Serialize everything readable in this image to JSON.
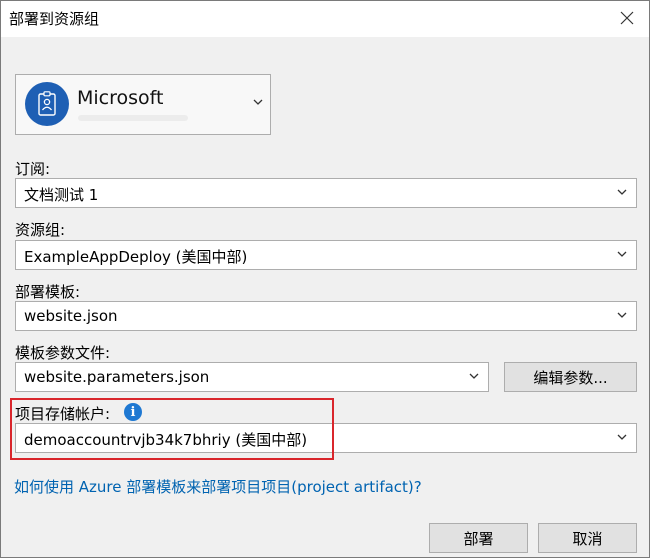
{
  "dialog": {
    "title": "部署到资源组",
    "close_icon": "close-icon"
  },
  "account": {
    "name": "Microsoft",
    "icon": "id-badge-icon"
  },
  "subscription": {
    "label": "订阅:",
    "value": "文档测试 1"
  },
  "resource_group": {
    "label": "资源组:",
    "value": "ExampleAppDeploy (美国中部)"
  },
  "deployment_template": {
    "label": "部署模板:",
    "value": "website.json"
  },
  "template_parameters": {
    "label": "模板参数文件:",
    "value": "website.parameters.json",
    "edit_button": "编辑参数..."
  },
  "storage_account": {
    "label": "项目存储帐户:",
    "value": "demoaccountrvjb34k7bhriy (美国中部)",
    "info_icon": "info-icon",
    "highlight_color": "#d9262c"
  },
  "help_link": "如何使用 Azure 部署模板来部署项目项目(project artifact)?",
  "buttons": {
    "deploy": "部署",
    "cancel": "取消"
  },
  "colors": {
    "accent": "#1e78d2",
    "link": "#0063b1"
  }
}
